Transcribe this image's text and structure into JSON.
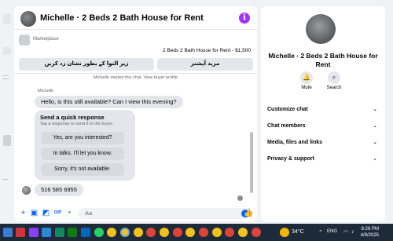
{
  "chat": {
    "header_title": "Michelle · 2 Beds 2 Bath House for Rent",
    "info_glyph": "i",
    "marketplace_label": "Marketplace",
    "listing_price_line": "2 Beds 2 Bath House for Rent - $1,500",
    "btn_mark_pending": "زیر التوا کے بطور نشان زد کریں",
    "btn_more_options": "مزید آپشنز",
    "started_text": "Michelle started this chat. View buyer profile",
    "sender_name": "Michelle",
    "message_1": "Hello, is this still available? Can I view this evening?",
    "quick_title": "Send a quick response",
    "quick_subtitle": "Tap a response to send it to the buyer.",
    "quick_replies": [
      "Yes, are you interested?",
      "In talks. I'll let you know.",
      "Sorry, it's not available."
    ],
    "message_2": "516 585 6955",
    "composer_placeholder": "Aa"
  },
  "panel": {
    "title": "Michelle · 2 Beds 2 Bath House for Rent",
    "mute_label": "Mute",
    "search_label": "Search",
    "sections": [
      "Customize chat",
      "Chat members",
      "Media, files and links",
      "Privacy & support"
    ]
  },
  "taskbar": {
    "temperature": "34°C",
    "time": "8:26 PM",
    "date": "4/9/2025",
    "lang": "ENG"
  },
  "colors": {
    "accent": "#0866ff",
    "info": "#a033ff",
    "taskbar": "#1c2a3a"
  }
}
